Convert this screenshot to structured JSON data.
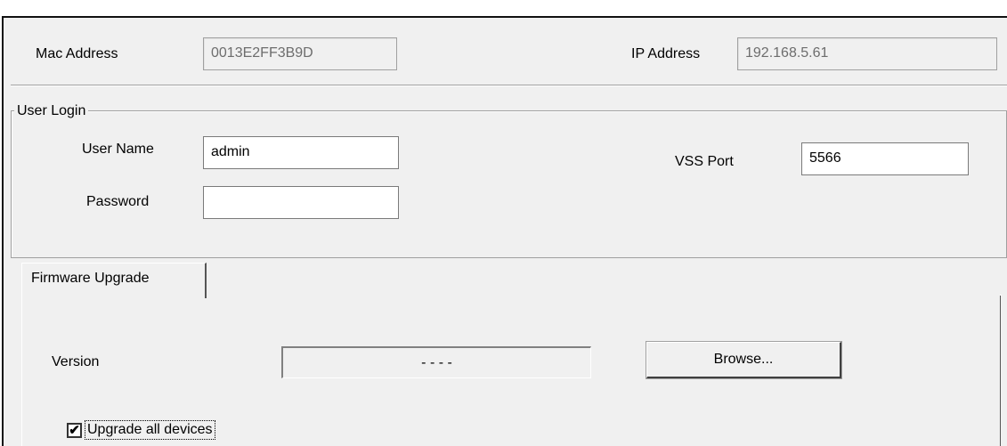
{
  "network": {
    "mac_label": "Mac Address",
    "mac_value": "0013E2FF3B9D",
    "ip_label": "IP Address",
    "ip_value": "192.168.5.61"
  },
  "user_login": {
    "group_title": "User Login",
    "username_label": "User Name",
    "username_value": "admin",
    "password_label": "Password",
    "password_value": "",
    "vss_port_label": "VSS Port",
    "vss_port_value": "5566"
  },
  "firmware": {
    "tab_label": "Firmware Upgrade",
    "version_label": "Version",
    "version_value": "- - - -",
    "browse_label": "Browse...",
    "upgrade_all_label": "Upgrade all devices",
    "upgrade_all_checked": true,
    "check_glyph": "✔"
  }
}
